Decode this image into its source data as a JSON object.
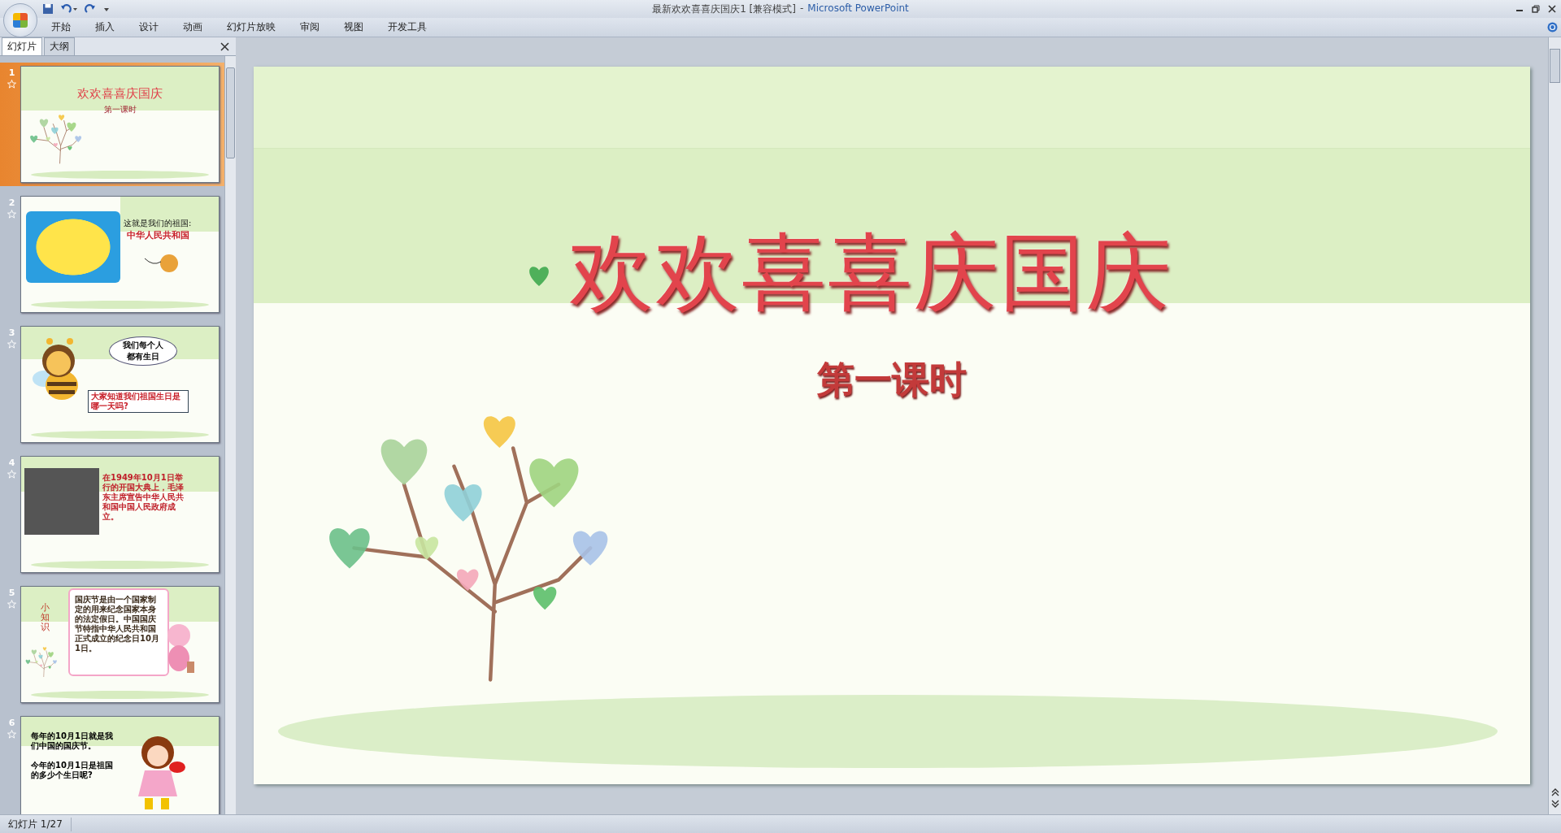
{
  "window": {
    "document": "最新欢欢喜喜庆国庆1 [兼容模式]",
    "separator": "-",
    "app": "Microsoft PowerPoint"
  },
  "ribbon_tabs": [
    {
      "label": "开始",
      "selected": false
    },
    {
      "label": "插入",
      "selected": false
    },
    {
      "label": "设计",
      "selected": false
    },
    {
      "label": "动画",
      "selected": false
    },
    {
      "label": "幻灯片放映",
      "selected": false
    },
    {
      "label": "审阅",
      "selected": false
    },
    {
      "label": "视图",
      "selected": false
    },
    {
      "label": "开发工具",
      "selected": false
    }
  ],
  "panel_tabs": [
    {
      "label": "幻灯片",
      "selected": true
    },
    {
      "label": "大纲",
      "selected": false
    }
  ],
  "slides": [
    {
      "number": "1",
      "selected": true,
      "kind": "title",
      "title": "欢欢喜喜庆国庆",
      "subtitle": "第一课时"
    },
    {
      "number": "2",
      "selected": false,
      "kind": "map",
      "caption": "这就是我们的祖国:",
      "heading": "中华人民共和国"
    },
    {
      "number": "3",
      "selected": false,
      "kind": "bee",
      "bubble": [
        "我们每个人",
        "都有生日"
      ],
      "question": "大家知道我们祖国生日是哪一天吗?"
    },
    {
      "number": "4",
      "selected": false,
      "kind": "photo",
      "text": "在1949年10月1日举行的开国大典上，毛泽东主席宣告中华人民共和国中国人民政府成立。"
    },
    {
      "number": "5",
      "selected": false,
      "kind": "knowledge",
      "side": "小知识",
      "text": "国庆节是由一个国家制定的用来纪念国家本身的法定假日。中国国庆节特指中华人民共和国正式成立的纪念日10月1日。"
    },
    {
      "number": "6",
      "selected": false,
      "kind": "girl",
      "paragraphs": [
        "每年的10月1日就是我们中国的国庆节。",
        "今年的10月1日是祖国的多少个生日呢?"
      ]
    }
  ],
  "main_slide": {
    "title": "欢欢喜喜庆国庆",
    "subtitle": "第一课时"
  },
  "status_bar": {
    "slide_info": "幻灯片 1/27"
  }
}
